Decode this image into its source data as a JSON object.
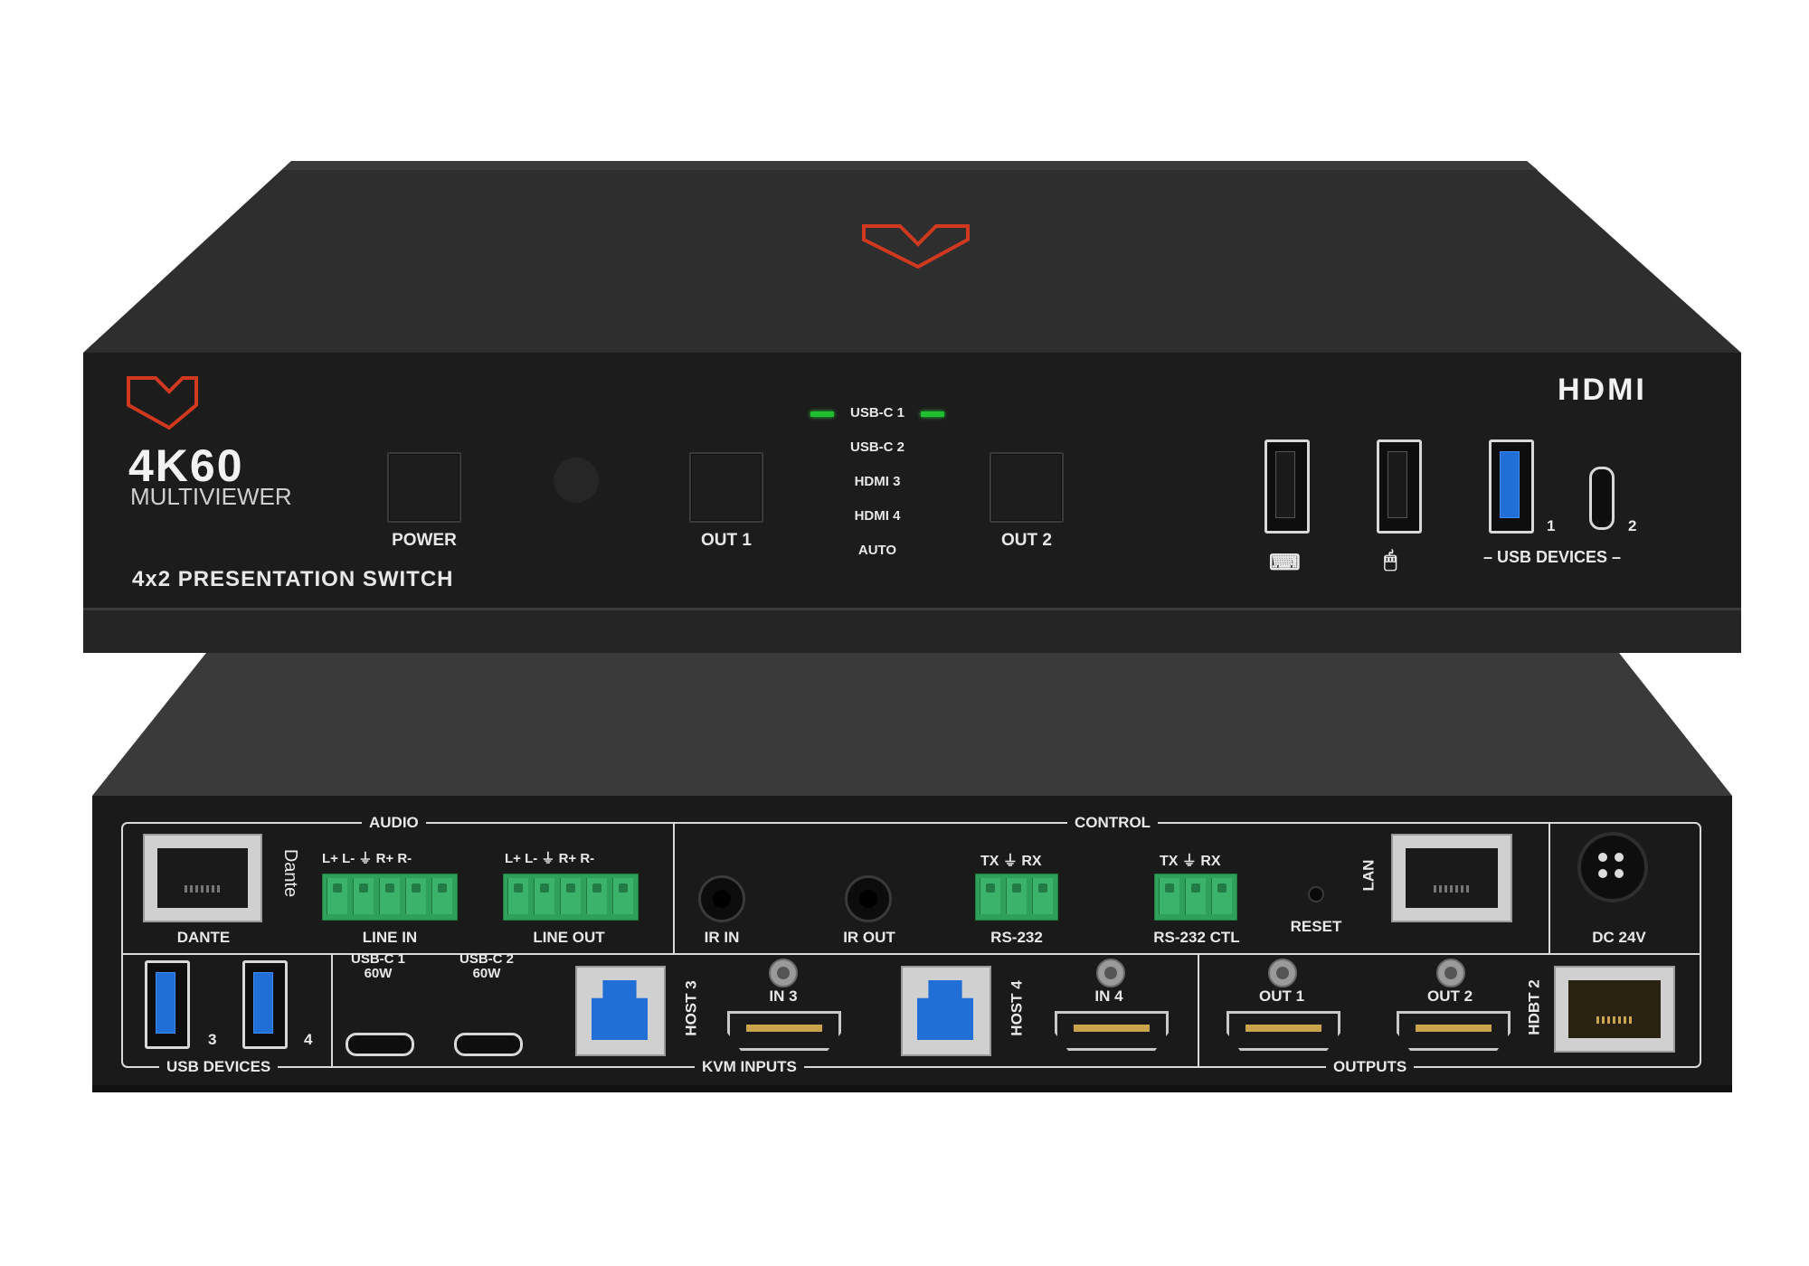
{
  "front_panel": {
    "model_big": "4K60",
    "model_sub": "MULTIVIEWER",
    "product_name": "4x2 PRESENTATION SWITCH",
    "hdmi_logo": "HDMI",
    "buttons": {
      "power": "POWER",
      "out1": "OUT 1",
      "out2": "OUT 2"
    },
    "led_rows": [
      {
        "label": "USB-C 1",
        "left_on": true,
        "right_on": true
      },
      {
        "label": "USB-C 2",
        "left_on": false,
        "right_on": false
      },
      {
        "label": "HDMI 3",
        "left_on": false,
        "right_on": false
      },
      {
        "label": "HDMI 4",
        "left_on": false,
        "right_on": false
      },
      {
        "label": "AUTO",
        "left_on": false,
        "right_on": false
      }
    ],
    "usb_devices_label": "USB DEVICES",
    "usb_port_1": "1",
    "usb_port_2": "2",
    "keyboard_icon": "keyboard-icon",
    "mouse_icon": "mouse-icon",
    "led_on_color": "#1fbf2f",
    "brand_color": "#d0381f"
  },
  "rear_panel": {
    "audio_label": "AUDIO",
    "control_label": "CONTROL",
    "dante_label": "DANTE",
    "dante_brand": "Dante",
    "audio_pins_in": "L+ L-  ⏚  R+ R-",
    "audio_pins_out": "L+ L-  ⏚  R+ R-",
    "line_in": "LINE IN",
    "line_out": "LINE OUT",
    "ir_in": "IR IN",
    "ir_out": "IR OUT",
    "rs232_pins": "TX ⏚ RX",
    "rs232_ctl_pins": "TX ⏚ RX",
    "rs232": "RS-232",
    "rs232_ctl": "RS-232 CTL",
    "reset": "RESET",
    "lan": "LAN",
    "dc": "DC 24V",
    "usb_devices": "USB DEVICES",
    "usb3": "3",
    "usb4": "4",
    "usbc1": "USB-C 1",
    "usbc1_w": "60W",
    "usbc2": "USB-C 2",
    "usbc2_w": "60W",
    "host3": "HOST 3",
    "host4": "HOST 4",
    "in3": "IN 3",
    "in4": "IN 4",
    "kvm_inputs": "KVM INPUTS",
    "out1": "OUT 1",
    "out2": "OUT 2",
    "outputs": "OUTPUTS",
    "hdbt2": "HDBT 2"
  }
}
